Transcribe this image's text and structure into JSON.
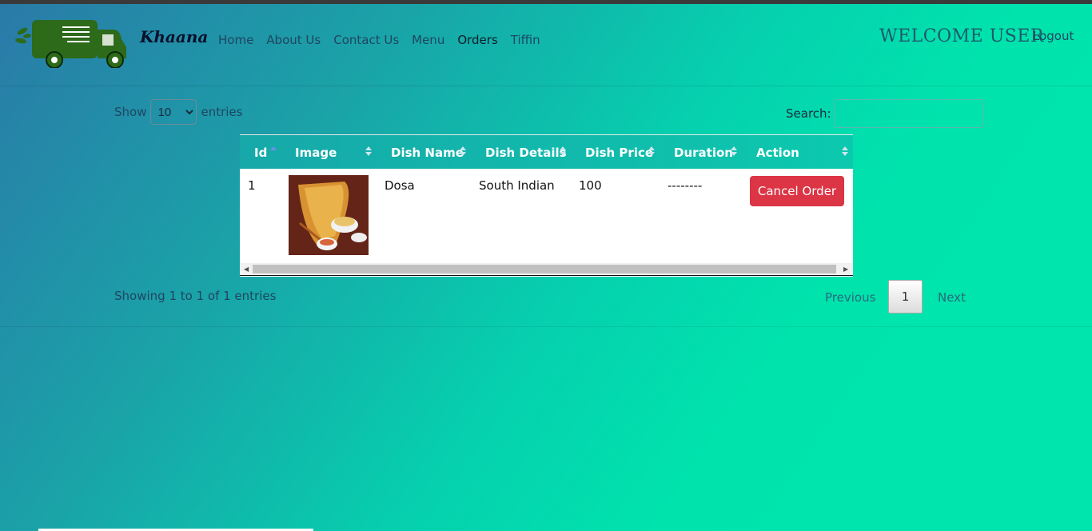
{
  "navbar": {
    "brand": "Khaana",
    "links": [
      "Home",
      "About Us",
      "Contact Us",
      "Menu",
      "Orders",
      "Tiffin"
    ],
    "welcome": "WELCOME USER",
    "logout": "Logout"
  },
  "table_controls": {
    "show_label": "Show",
    "entries_value": "10",
    "entries_label": "entries",
    "search_label": "Search:"
  },
  "table": {
    "columns": [
      "Id",
      "Image",
      "Dish Name",
      "Dish Details",
      "Dish Price",
      "Duration",
      "Action"
    ],
    "rows": [
      {
        "id": "1",
        "dish_name": "Dosa",
        "dish_details": "South Indian",
        "dish_price": "100",
        "duration": "--------",
        "action": "Cancel Order"
      }
    ]
  },
  "footer": {
    "info": "Showing 1 to 1 of 1 entries",
    "previous": "Previous",
    "page": "1",
    "next": "Next"
  },
  "colors": {
    "accent": "#dc3545",
    "logo_green": "#2d6a1a"
  }
}
